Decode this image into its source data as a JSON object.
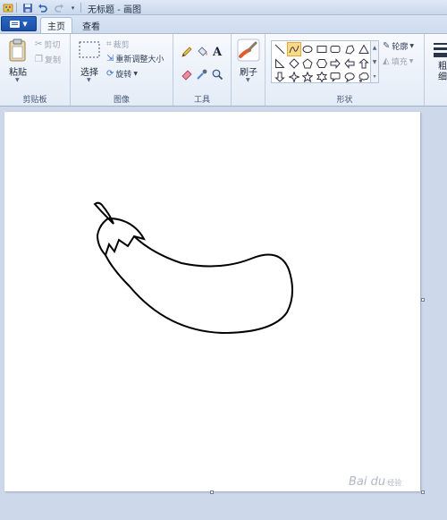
{
  "window": {
    "title": "无标题 - 画图"
  },
  "tabs": [
    {
      "label": "主页",
      "active": true
    },
    {
      "label": "查看",
      "active": false
    }
  ],
  "clipboard": {
    "paste": "粘贴",
    "cut": "剪切",
    "copy": "复制",
    "label": "剪贴板"
  },
  "image": {
    "select": "选择",
    "crop": "裁剪",
    "resize": "重新调整大小",
    "rotate": "旋转",
    "label": "图像"
  },
  "tools": {
    "label": "工具",
    "text_glyph": "A"
  },
  "brushes": {
    "label": "刷子"
  },
  "shapes": {
    "label": "形状",
    "outline": "轮廓",
    "fill": "填充",
    "items": [
      "line-shape-icon",
      "curve-shape-icon",
      "oval-shape-icon",
      "rectangle-shape-icon",
      "rounded-rectangle-shape-icon",
      "polygon-shape-icon",
      "triangle-shape-icon",
      "right-triangle-shape-icon",
      "diamond-shape-icon",
      "pentagon-shape-icon",
      "hexagon-shape-icon",
      "right-arrow-shape-icon",
      "left-arrow-shape-icon",
      "up-arrow-shape-icon",
      "down-arrow-shape-icon",
      "four-point-star-shape-icon",
      "five-point-star-shape-icon",
      "six-point-star-shape-icon",
      "rounded-callout-shape-icon",
      "oval-callout-shape-icon",
      "cloud-callout-shape-icon"
    ],
    "selected": "curve-shape-icon"
  },
  "size": {
    "label_partial": "粗细"
  },
  "watermark": {
    "text": "Bai du",
    "sub": "经验"
  },
  "colors": {
    "accent": "#1a4fa6",
    "canvas": "#ffffff",
    "workspace": "#cdd9ea",
    "selected_shape": "#fbd986"
  }
}
